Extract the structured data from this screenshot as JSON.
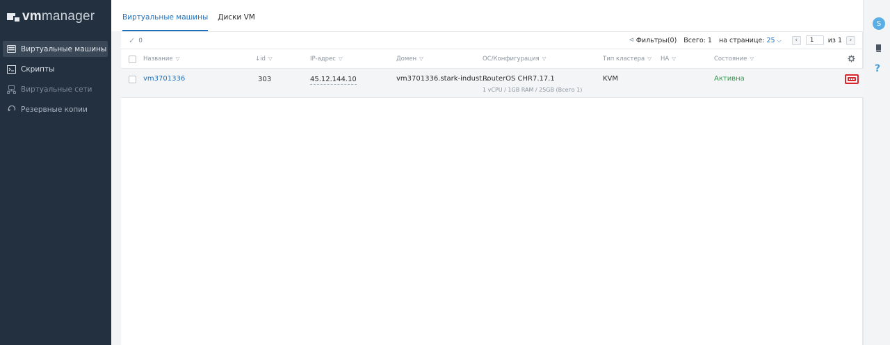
{
  "app": {
    "logo_bold": "vm",
    "logo_light": "manager"
  },
  "sidebar": {
    "items": [
      {
        "label": "Виртуальные машины",
        "icon": "vm-icon",
        "active": true
      },
      {
        "label": "Скрипты",
        "icon": "script-icon"
      },
      {
        "label": "Виртуальные сети",
        "icon": "network-icon",
        "disabled": true
      },
      {
        "label": "Резервные копии",
        "icon": "backup-icon"
      }
    ]
  },
  "tabs": [
    {
      "label": "Виртуальные машины",
      "active": true
    },
    {
      "label": "Диски VM"
    }
  ],
  "toolbar": {
    "selected_count": "0",
    "filters_label": "Фильтры(0)",
    "total_label": "Всего: 1",
    "per_page_label": "на странице:",
    "per_page_value": "25",
    "page_value": "1",
    "page_of_label": "из 1"
  },
  "table": {
    "columns": [
      {
        "label": "Название"
      },
      {
        "label": "↓id"
      },
      {
        "label": "IP-адрес"
      },
      {
        "label": "Домен"
      },
      {
        "label": "ОС/Конфигурация"
      },
      {
        "label": "Тип кластера"
      },
      {
        "label": "HA"
      },
      {
        "label": "Состояние"
      }
    ],
    "rows": [
      {
        "name": "vm3701336",
        "id": "303",
        "ip": "45.12.144.10",
        "domain": "vm3701336.stark-indust...",
        "os": "RouterOS CHR7.17.1",
        "config": "1 vCPU / 1GB RAM / 25GB (Всего 1)",
        "cluster": "KVM",
        "ha": "",
        "state": "Активна"
      }
    ]
  },
  "rail": {
    "avatar_letter": "S",
    "help": "?"
  },
  "colors": {
    "sidebar_bg": "#233040",
    "accent": "#1e6fba",
    "status_active": "#2e9a4a",
    "highlight": "#d9262d"
  }
}
